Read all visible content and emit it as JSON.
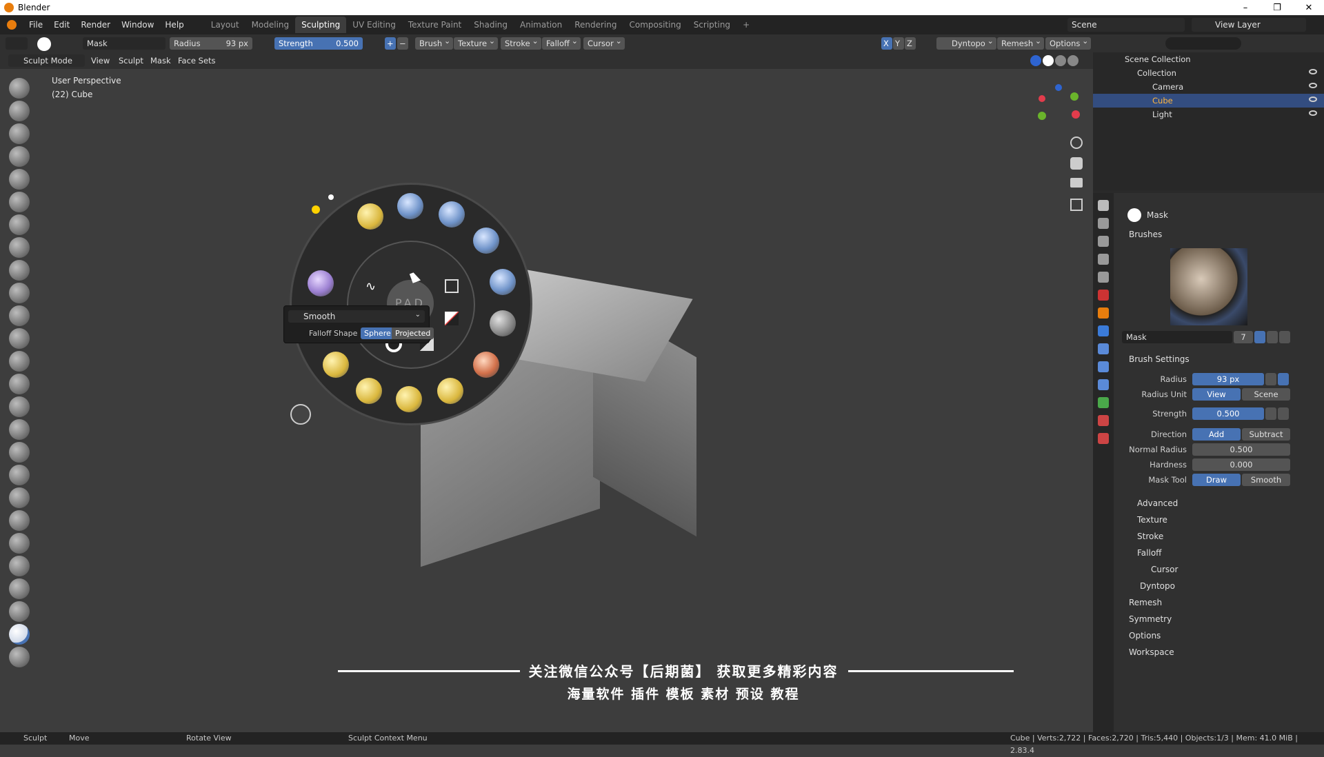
{
  "window": {
    "title": "Blender",
    "min": "–",
    "max": "❐",
    "close": "✕"
  },
  "menu": [
    "File",
    "Edit",
    "Render",
    "Window",
    "Help"
  ],
  "workspaces": [
    "Layout",
    "Modeling",
    "Sculpting",
    "UV Editing",
    "Texture Paint",
    "Shading",
    "Animation",
    "Rendering",
    "Compositing",
    "Scripting",
    "+"
  ],
  "active_workspace": "Sculpting",
  "scene": {
    "label": "Scene",
    "view_layer": "View Layer"
  },
  "tool_header": {
    "brush_name": "Mask",
    "radius_label": "Radius",
    "radius_value": "93 px",
    "strength_label": "Strength",
    "strength_value": "0.500",
    "plus": "+",
    "minus": "−",
    "dropdowns": [
      "Brush",
      "Texture",
      "Stroke",
      "Falloff",
      "Cursor"
    ],
    "axis": [
      "X",
      "Y",
      "Z"
    ],
    "dyntopo": "Dyntopo",
    "remesh": "Remesh",
    "options": "Options"
  },
  "mode_bar": {
    "mode": "Sculpt Mode",
    "items": [
      "View",
      "Sculpt",
      "Mask",
      "Face Sets"
    ]
  },
  "viewport": {
    "line1": "User Perspective",
    "line2": "(22) Cube"
  },
  "pie": {
    "center": "PAD",
    "popup_dropdown": "Smooth",
    "falloff_label": "Falloff Shape",
    "sphere": "Sphere",
    "projected": "Projected"
  },
  "watermark": {
    "line1": "关注微信公众号【后期菌】 获取更多精彩内容",
    "line2": "海量软件 插件 模板 素材 预设 教程"
  },
  "outliner": {
    "scene_collection": "Scene Collection",
    "collection": "Collection",
    "camera": "Camera",
    "cube": "Cube",
    "light": "Light"
  },
  "properties": {
    "tool_name": "Mask",
    "brushes": "Brushes",
    "brush_field": "Mask",
    "brush_users": "7",
    "brush_settings": "Brush Settings",
    "radius_label": "Radius",
    "radius_value": "93 px",
    "radius_unit_label": "Radius Unit",
    "view": "View",
    "scene": "Scene",
    "strength_label": "Strength",
    "strength_value": "0.500",
    "direction_label": "Direction",
    "add": "Add",
    "subtract": "Subtract",
    "normal_radius_label": "Normal Radius",
    "normal_radius_value": "0.500",
    "hardness_label": "Hardness",
    "hardness_value": "0.000",
    "mask_tool_label": "Mask Tool",
    "draw": "Draw",
    "smooth": "Smooth",
    "subpanels": [
      "Advanced",
      "Texture",
      "Stroke",
      "Falloff",
      "Cursor"
    ],
    "panels": [
      "Dyntopo",
      "Remesh",
      "Symmetry",
      "Options",
      "Workspace"
    ]
  },
  "status": {
    "sculpt": "Sculpt",
    "move": "Move",
    "rotate": "Rotate View",
    "context": "Sculpt Context Menu",
    "stats": "Cube | Verts:2,722 | Faces:2,720 | Tris:5,440 | Objects:1/3 | Mem: 41.0 MiB | 2.83.4"
  },
  "colors": {
    "accent": "#4772b3",
    "selection": "#334d80",
    "bg": "#3d3d3d"
  }
}
